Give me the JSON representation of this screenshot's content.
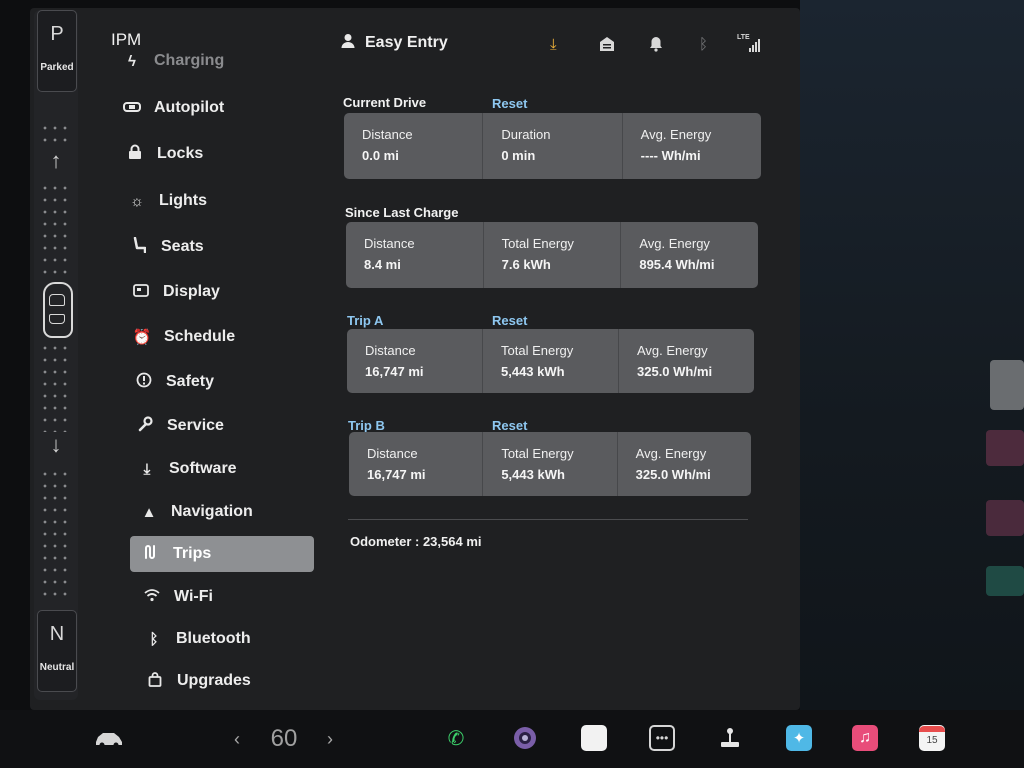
{
  "colors": {
    "accent_blue": "#8ec7f0",
    "download_yellow": "#f0b33a",
    "phone_green": "#3ccf6a",
    "active_nav": "#8e9093"
  },
  "gear": {
    "top_letter": "P",
    "top_label": "Parked",
    "bottom_letter": "N",
    "bottom_label": "Neutral",
    "icons": [
      "arrow-up-icon",
      "car-top-view-icon",
      "arrow-down-icon"
    ]
  },
  "sidebar": {
    "header": "IPM",
    "items": [
      {
        "label": "Charging",
        "icon": "lightning-icon"
      },
      {
        "label": "Autopilot",
        "icon": "steering-wheel-icon"
      },
      {
        "label": "Locks",
        "icon": "lock-icon"
      },
      {
        "label": "Lights",
        "icon": "sun-icon"
      },
      {
        "label": "Seats",
        "icon": "seat-icon"
      },
      {
        "label": "Display",
        "icon": "display-icon"
      },
      {
        "label": "Schedule",
        "icon": "alarm-clock-icon"
      },
      {
        "label": "Safety",
        "icon": "alert-circle-icon"
      },
      {
        "label": "Service",
        "icon": "wrench-icon"
      },
      {
        "label": "Software",
        "icon": "download-icon"
      },
      {
        "label": "Navigation",
        "icon": "navigation-arrow-icon"
      },
      {
        "label": "Trips",
        "icon": "trips-icon"
      },
      {
        "label": "Wi-Fi",
        "icon": "wifi-icon"
      },
      {
        "label": "Bluetooth",
        "icon": "bluetooth-icon"
      },
      {
        "label": "Upgrades",
        "icon": "bag-icon"
      }
    ],
    "active": "Trips"
  },
  "header": {
    "profile": "Easy Entry",
    "status_icons": [
      "download-icon",
      "garage-icon",
      "bell-icon",
      "bluetooth-icon",
      "lte-signal-icon"
    ],
    "lte_label": "LTE"
  },
  "trips": {
    "current_drive": {
      "title": "Current Drive",
      "reset": "Reset",
      "cells": [
        {
          "label": "Distance",
          "value": "0.0 mi"
        },
        {
          "label": "Duration",
          "value": "0 min"
        },
        {
          "label": "Avg. Energy",
          "value": "---- Wh/mi"
        }
      ]
    },
    "since_last_charge": {
      "title": "Since Last Charge",
      "cells": [
        {
          "label": "Distance",
          "value": "8.4 mi"
        },
        {
          "label": "Total Energy",
          "value": "7.6 kWh"
        },
        {
          "label": "Avg. Energy",
          "value": "895.4 Wh/mi"
        }
      ]
    },
    "trip_a": {
      "title": "Trip A",
      "reset": "Reset",
      "cells": [
        {
          "label": "Distance",
          "value": "16,747 mi"
        },
        {
          "label": "Total Energy",
          "value": "5,443 kWh"
        },
        {
          "label": "Avg. Energy",
          "value": "325.0 Wh/mi"
        }
      ]
    },
    "trip_b": {
      "title": "Trip B",
      "reset": "Reset",
      "cells": [
        {
          "label": "Distance",
          "value": "16,747 mi"
        },
        {
          "label": "Total Energy",
          "value": "5,443 kWh"
        },
        {
          "label": "Avg. Energy",
          "value": "325.0 Wh/mi"
        }
      ]
    },
    "odometer": "Odometer : 23,564 mi"
  },
  "taskbar": {
    "speed": "60",
    "left_chevron": "‹",
    "right_chevron": "›",
    "calendar_day": "15",
    "icons": [
      "car-icon",
      "phone-icon",
      "camera-icon",
      "notes-icon",
      "more-apps-icon",
      "joystick-icon",
      "toybox-icon",
      "music-icon",
      "calendar-icon"
    ]
  }
}
